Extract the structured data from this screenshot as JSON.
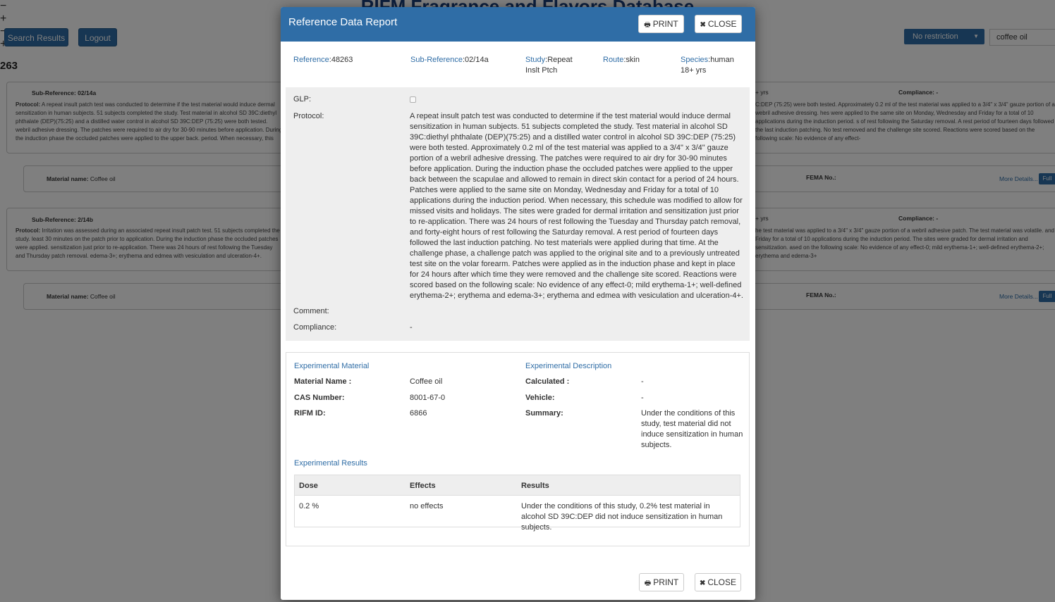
{
  "background": {
    "db_title": "RIFM Fragrance and Flavors Database",
    "nav": {
      "search_results": "Search Results",
      "logout": "Logout"
    },
    "restriction": "No restriction",
    "search_value": "coffee oil",
    "result_count": "263",
    "card1": {
      "sub_reference": "Sub-Reference: 02/14a",
      "protocol_label": "Protocol:",
      "protocol_text": "A repeat insult patch test was conducted to determine if the test material would induce dermal sensitization in human subjects. 51 subjects completed the study. Test material in alcohol SD 39C:diethyl phthalate (DEP)(75:25) and a distilled water control in alcohol SD 39C:DEP (75:25) were both tested. webril adhesive dressing. The patches were required to air dry for 30-90 minutes before application. During the induction phase the occluded patches were applied to the upper back. period. When necessary, this schedule was modified to allow for missed visits and holidays. The sites were graded. materials were applied during that time. At the challenge phase, a challenge patch was applied to the original site. 0; mild erythema-1+; well-defined erythema-2+; erythema and edema-3+; erythema and edmea with vesiculation and ulceration-4+.",
      "right_fragment": "+ yrs",
      "compliance": "Compliance: -",
      "right_text": "C:DEP (75:25) were both tested. Approximately 0.2 ml of the test material was applied to a 3/4\" x 3/4\" gauze portion of a webril adhesive dressing. hes were applied to the same site on Monday, Wednesday and Friday for a total of 10 applications during the induction period. s of rest following the Saturday removal. A rest period of fourteen days followed the last induction patching. No test removed and the challenge site scored. Reactions were scored based on the following scale: No evidence of any effect-"
    },
    "material1": {
      "label": "Material name:",
      "value": "Coffee oil",
      "fema": "FEMA No.:",
      "more": "More Details...",
      "full": "Full"
    },
    "card2": {
      "sub_reference": "Sub-Reference: 2/14b",
      "protocol_label": "Protocol:",
      "protocol_text": "Irritation was assessed during an associated repeat insult patch test. 51 subjects completed the study. least 30 minutes on the patch prior to application. During the induction phase the occluded patches were applied. sensitization just prior to re-application. There was 24 hours of rest following the Tuesday and Thursday patch removal. edema-3+; erythema and edmea with vesiculation and ulceration-4+.",
      "right_fragment": "+ yrs",
      "compliance": "Compliance: -",
      "right_text": "he test material was applied to a 3/4\" x 3/4\" gauze portion of a webril adhesive patch. The test material was volatile. and Friday for a total of 10 applications during the induction period. The sites were graded for dermal irritation and sensitization. ased on the following scale: No evidence of any effect-0; mild erythema-1+; well-defined erythema-2+; erythema and edema-3+"
    },
    "material2": {
      "label": "Material name:",
      "value": "Coffee oil",
      "fema": "FEMA No.:",
      "more": "More Details...",
      "full": "Full"
    }
  },
  "modal": {
    "title": "Reference Data Report",
    "print_label": "PRINT",
    "close_label": "CLOSE",
    "reference": {
      "label": "Reference",
      "value": ":48263"
    },
    "sub_reference": {
      "label": "Sub-Reference",
      "value": ":02/14a"
    },
    "study": {
      "label": "Study",
      "value": ":Repeat Inslt Ptch"
    },
    "route": {
      "label": "Route",
      "value": ":skin"
    },
    "species": {
      "label": "Species",
      "value": ":human 18+ yrs"
    },
    "glp_label": "GLP:",
    "glp_checked": false,
    "protocol_label": "Protocol:",
    "protocol_text": "A repeat insult patch test was conducted to determine if the test material would induce dermal sensitization in human subjects. 51 subjects completed the study. Test material in alcohol SD 39C:diethyl phthalate (DEP)(75:25) and a distilled water control in alcohol SD 39C:DEP (75:25) were both tested. Approximately 0.2 ml of the test material was applied to a 3/4\" x 3/4\" gauze portion of a webril adhesive dressing. The patches were required to air dry for 30-90 minutes before application. During the induction phase the occluded patches were applied to the upper back between the scapulae and allowed to remain in direct skin contact for a period of 24 hours. Patches were applied to the same site on Monday, Wednesday and Friday for a total of 10 applications during the induction period. When necessary, this schedule was modified to allow for missed visits and holidays. The sites were graded for dermal irritation and sensitization just prior to re-application. There was 24 hours of rest following the Tuesday and Thursday patch removal, and forty-eight hours of rest following the Saturday removal. A rest period of fourteen days followed the last induction patching. No test materials were applied during that time. At the challenge phase, a challenge patch was applied to the original site and to a previously untreated test site on the volar forearm. Patches were applied as in the induction phase and kept in place for 24 hours after which time they were removed and the challenge site scored. Reactions were scored based on the following scale: No evidence of any effect-0; mild erythema-1+; well-defined erythema-2+; erythema and edema-3+; erythema and edmea with vesiculation and ulceration-4+.",
    "comment_label": "Comment:",
    "compliance_label": "Compliance:",
    "compliance_value": "-",
    "experimental_material": {
      "title": "Experimental Material",
      "material_name_label": "Material Name :",
      "material_name": "Coffee oil",
      "cas_label": "CAS Number:",
      "cas": "8001-67-0",
      "rifm_label": "RIFM ID:",
      "rifm": "6866"
    },
    "experimental_description": {
      "title": "Experimental Description",
      "calculated_label": "Calculated :",
      "calculated": "-",
      "vehicle_label": "Vehicle:",
      "vehicle": "-",
      "summary_label": "Summary:",
      "summary": "Under the conditions of this study, test material did not induce sensitization in human subjects."
    },
    "experimental_results": {
      "title": "Experimental Results",
      "headers": [
        "Dose",
        "Effects",
        "Results"
      ],
      "rows": [
        {
          "dose": "0.2 %",
          "effects": "no effects",
          "results": "Under the conditions of this study, 0.2% test material in alcohol SD 39C:DEP did not induce sensitization in human subjects."
        }
      ]
    }
  },
  "colors": {
    "primary": "#2f6da6",
    "overlay": "rgba(0,0,0,0.5)",
    "panel_gray": "#eeeeee"
  },
  "icons": {
    "print": "print-icon",
    "close": "close-icon"
  }
}
